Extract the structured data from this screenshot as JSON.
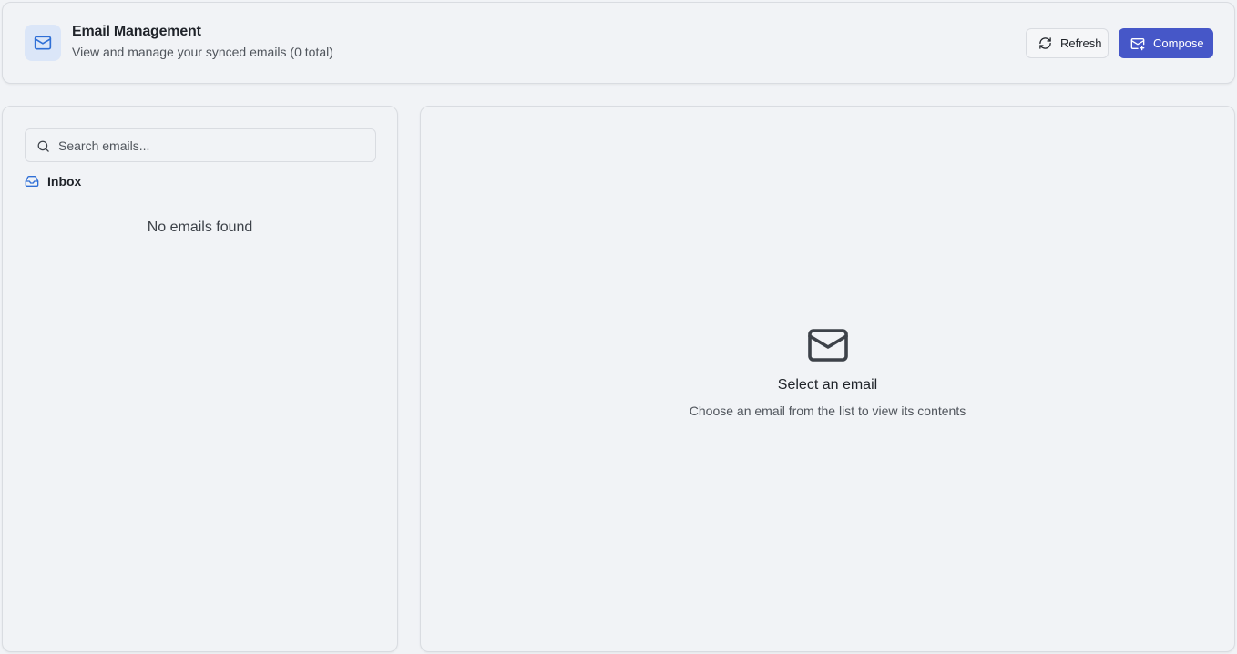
{
  "header": {
    "title": "Email Management",
    "subtitle": "View and manage your synced emails (0 total)",
    "icon": "mail-icon",
    "refresh_label": "Refresh",
    "compose_label": "Compose"
  },
  "sidebar": {
    "search": {
      "placeholder": "Search emails...",
      "value": ""
    },
    "folder": {
      "label": "Inbox",
      "icon": "inbox-icon"
    },
    "empty_message": "No emails found"
  },
  "viewer": {
    "empty_title": "Select an email",
    "empty_description": "Choose an email from the list to view its contents"
  },
  "colors": {
    "accent": "#4657c8",
    "icon_blue": "#2f6fd6",
    "background": "#f1f3f6",
    "border": "#d9dce1"
  }
}
